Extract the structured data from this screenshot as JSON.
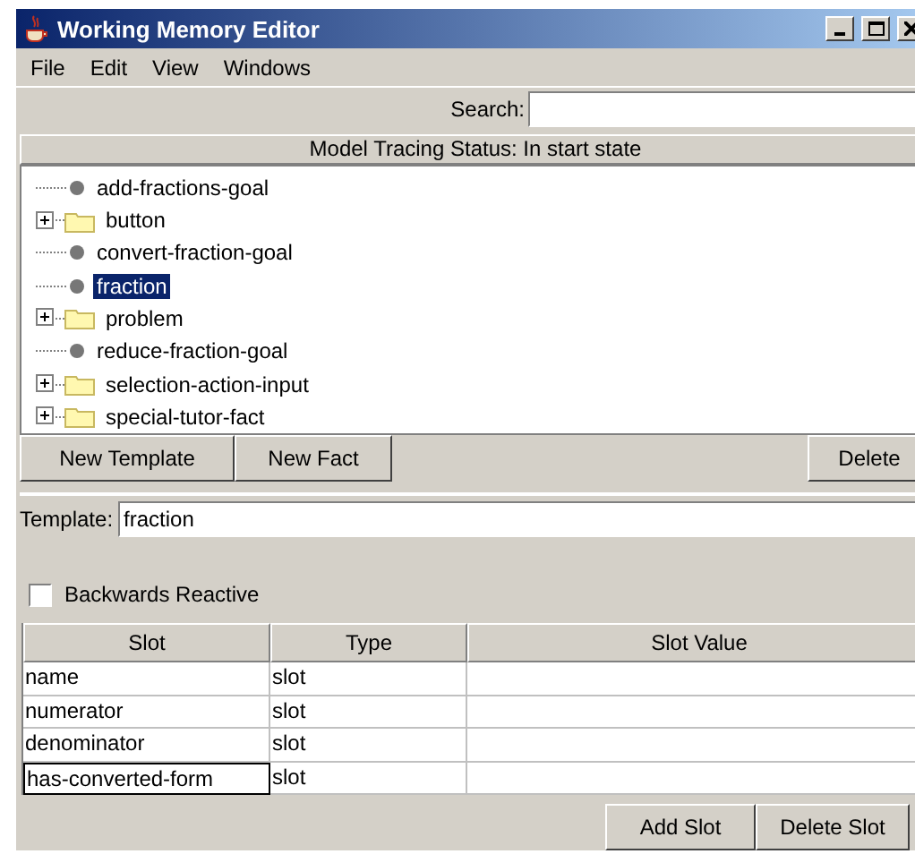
{
  "window": {
    "title": "Working Memory Editor"
  },
  "menu": [
    {
      "label": "File"
    },
    {
      "label": "Edit"
    },
    {
      "label": "View"
    },
    {
      "label": "Windows"
    }
  ],
  "search": {
    "label": "Search:"
  },
  "status": "Model Tracing Status: In start state",
  "tree": [
    {
      "kind": "leaf",
      "label": "add-fractions-goal",
      "selected": false
    },
    {
      "kind": "folder",
      "label": "button",
      "selected": false,
      "expanded": false
    },
    {
      "kind": "leaf",
      "label": "convert-fraction-goal",
      "selected": false
    },
    {
      "kind": "leaf",
      "label": "fraction",
      "selected": true
    },
    {
      "kind": "folder",
      "label": "problem",
      "selected": false,
      "expanded": false
    },
    {
      "kind": "leaf",
      "label": "reduce-fraction-goal",
      "selected": false
    },
    {
      "kind": "folder",
      "label": "selection-action-input",
      "selected": false,
      "expanded": false
    },
    {
      "kind": "folder",
      "label": "special-tutor-fact",
      "selected": false,
      "expanded": false
    }
  ],
  "tree_buttons": [
    "New Template",
    "New Fact",
    "Delete"
  ],
  "template": {
    "label": "Template:",
    "value": "fraction"
  },
  "backwards_reactive": {
    "label": "Backwards Reactive",
    "checked": false
  },
  "table": {
    "columns": [
      "Slot",
      "Type",
      "Slot Value"
    ],
    "rows": [
      {
        "slot": "name",
        "type": "slot",
        "editing": false
      },
      {
        "slot": "numerator",
        "type": "slot",
        "editing": false
      },
      {
        "slot": "denominator",
        "type": "slot",
        "editing": false
      },
      {
        "slot": "has-converted-form",
        "type": "slot",
        "editing": true
      }
    ]
  },
  "slot_buttons": [
    "Add Slot",
    "Delete Slot"
  ]
}
